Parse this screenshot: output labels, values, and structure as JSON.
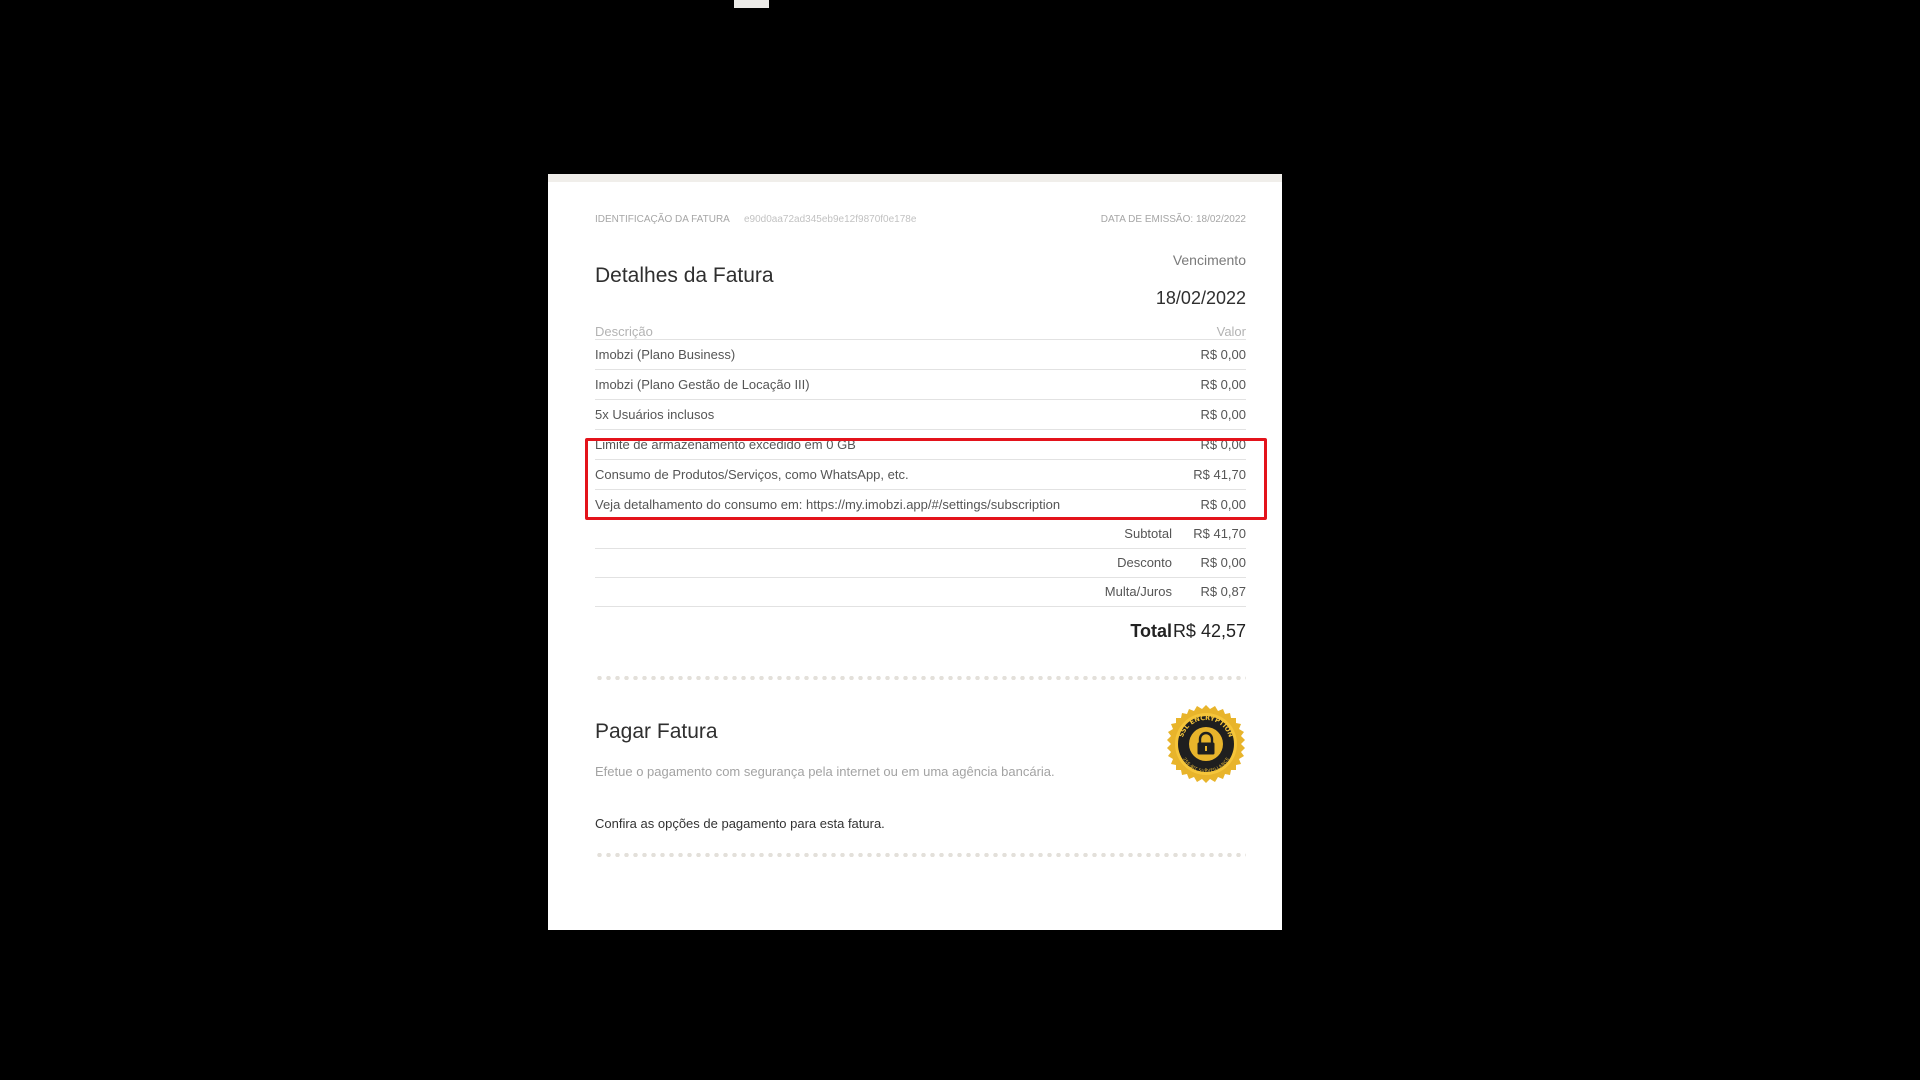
{
  "invoice": {
    "id_label": "IDENTIFICAÇÃO DA FATURA",
    "id_value": "e90d0aa72ad345eb9e12f9870f0e178e",
    "emission": "DATA DE EMISSÃO: 18/02/2022",
    "title": "Detalhes da Fatura",
    "due_label": "Vencimento",
    "due_date": "18/02/2022",
    "table": {
      "header_desc": "Descrição",
      "header_val": "Valor",
      "rows": [
        {
          "desc": "Imobzi (Plano Business)",
          "val": "R$ 0,00"
        },
        {
          "desc": "Imobzi (Plano Gestão de Locação III)",
          "val": "R$ 0,00"
        },
        {
          "desc": "5x Usuários inclusos",
          "val": "R$ 0,00"
        },
        {
          "desc": "Limite de armazenamento excedido em 0 GB",
          "val": "R$ 0,00"
        },
        {
          "desc": "Consumo de Produtos/Serviços, como WhatsApp, etc.",
          "val": "R$ 41,70"
        },
        {
          "desc": "Veja detalhamento do consumo em: https://my.imobzi.app/#/settings/subscription",
          "val": "R$ 0,00"
        }
      ]
    },
    "summary": {
      "subtotal_label": "Subtotal",
      "subtotal": "R$ 41,70",
      "discount_label": "Desconto",
      "discount": "R$ 0,00",
      "fine_label": "Multa/Juros",
      "fine": "R$ 0,87",
      "total_label": "Total",
      "total": "R$ 42,57"
    }
  },
  "payment": {
    "title": "Pagar Fatura",
    "description": "Efetue o pagamento com segurança pela internet ou em uma agência bancária.",
    "options_text": "Confira as opções de pagamento para esta fatura.",
    "badge_top": "SSL ENCRYPTION",
    "badge_bottom": "256-BIT SURVEILLANCE"
  },
  "colors": {
    "highlight": "#e3131b",
    "badge_gold": "#e8b42b",
    "badge_dark": "#1f1f1f"
  },
  "icons": {
    "badge": "lock-icon"
  }
}
